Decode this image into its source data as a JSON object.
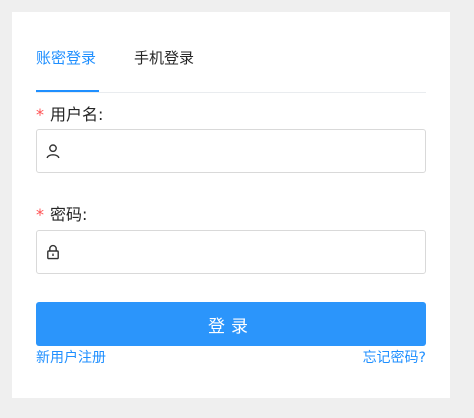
{
  "tabs": [
    {
      "label": "账密登录",
      "active": true
    },
    {
      "label": "手机登录",
      "active": false
    }
  ],
  "form": {
    "required_mark": "*",
    "username": {
      "label": "用户名:",
      "value": "",
      "placeholder": "",
      "icon": "user-icon"
    },
    "password": {
      "label": "密码:",
      "value": "",
      "placeholder": "",
      "icon": "lock-icon"
    },
    "login_label": "登录"
  },
  "links": {
    "register": "新用户注册",
    "forgot": "忘记密码?"
  },
  "colors": {
    "accent": "#1f8fff",
    "button": "#2b95fb",
    "required": "#ff4d4f",
    "background": "#efefef"
  }
}
